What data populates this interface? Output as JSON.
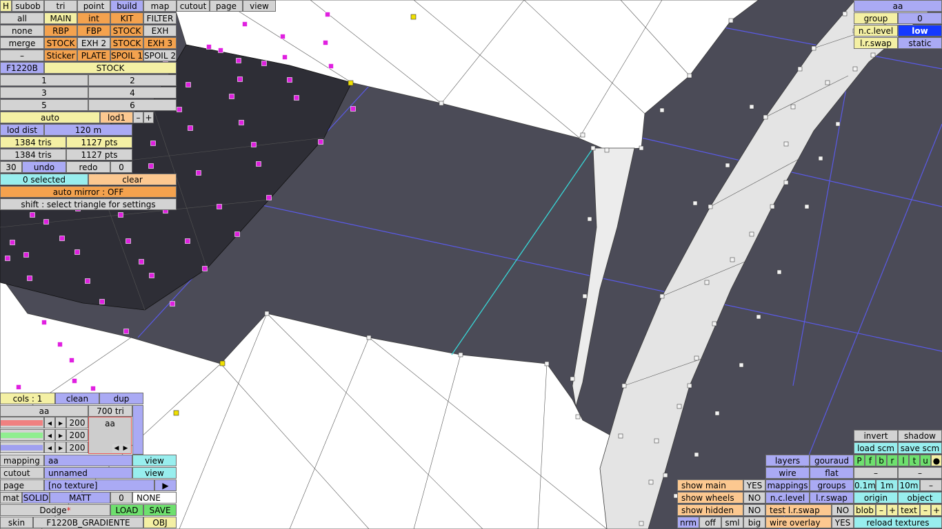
{
  "colors": {
    "background": "#4b4b57",
    "mesh_fill": "#ffffff",
    "wire": "#2a2a2a",
    "selected_vertex": "#e020e0",
    "yellow_vertex": "#f0e000",
    "axis_line": "#5a5ae8",
    "highlight_edge": "#38d8d8"
  },
  "top_menu": {
    "h": "H",
    "tabs": [
      "subob",
      "tri",
      "point",
      "build",
      "map",
      "cutout",
      "page",
      "view"
    ],
    "active_tab": "build"
  },
  "select": {
    "all": "all",
    "none": "none",
    "merge": "merge",
    "dash": "–",
    "grid": [
      [
        "MAIN",
        "int",
        "KIT",
        "FILTER"
      ],
      [
        "RBP",
        "FBP",
        "STOCK",
        "EXH"
      ],
      [
        "STOCK",
        "EXH 2",
        "STOCK",
        "EXH 3"
      ],
      [
        "Sticker",
        "PLATE",
        "SPOIL 1",
        "SPOIL 2"
      ]
    ]
  },
  "model": {
    "name": "F1220B",
    "variant": "STOCK"
  },
  "numbers": [
    "1",
    "2",
    "3",
    "4",
    "5",
    "6"
  ],
  "lod": {
    "auto": "auto",
    "current": "lod1",
    "minus": "–",
    "plus": "+",
    "dist_label": "lod dist",
    "dist_value": "120 m",
    "row1_tris": "1384 tris",
    "row1_pts": "1127 pts",
    "row2_tris": "1384 tris",
    "row2_pts": "1127 pts"
  },
  "history": {
    "count": "30",
    "undo": "undo",
    "redo": "redo",
    "redo_count": "0"
  },
  "selection": {
    "selected": "0 selected",
    "clear": "clear",
    "auto_mirror": "auto mirror : OFF",
    "hint": "shift : select triangle for settings"
  },
  "material": {
    "cols": "cols : 1",
    "clean": "clean",
    "dup": "dup",
    "name": "aa",
    "tri_count": "700 tri",
    "r": "200",
    "g": "200",
    "b": "200",
    "preview_name": "aa",
    "mapping_label": "mapping",
    "mapping_value": "aa",
    "mapping_view": "view",
    "cutout_label": "cutout",
    "cutout_value": "unnamed",
    "cutout_view": "view",
    "page_label": "page",
    "page_value": "[no texture]",
    "page_arrow": "▶",
    "mat": "mat",
    "solid": "SOLID",
    "matt": "MATT",
    "mat_num": "0",
    "mat_none": "NONE",
    "project_name": "Dodge",
    "project_star": "*",
    "load": "LOAD",
    "save": "SAVE",
    "skin_label": "skin",
    "skin_value": "F1220B_GRADIENTE",
    "obj": "OBJ"
  },
  "group_panel": {
    "title": "aa",
    "group_label": "group",
    "group_value": "0",
    "nc_level_label": "n.c.level",
    "nc_level_value": "low",
    "lr_swap_label": "l.r.swap",
    "lr_swap_value": "static"
  },
  "view_panel": {
    "invert": "invert",
    "shadow": "shadow",
    "load_scm": "load scm",
    "save_scm": "save scm",
    "layers": "layers",
    "gouraud": "gouraud",
    "wire": "wire",
    "flat": "flat",
    "mappings": "mappings",
    "groups": "groups",
    "dist_01": "0.1m",
    "dist_1": "1m",
    "dist_10": "10m",
    "nc_level": "n.c.level",
    "lr_swap": "l.r.swap",
    "origin": "origin",
    "object": "object",
    "test_lr_swap": "test l.r.swap",
    "test_lr_value": "NO",
    "blob": "blob",
    "text": "text",
    "minus": "–",
    "plus": "+",
    "wire_overlay": "wire overlay",
    "wire_overlay_value": "YES",
    "reload_textures": "reload textures",
    "filter_letters": [
      "P",
      "f",
      "b",
      "r",
      "l",
      "t",
      "u"
    ],
    "dash": "–",
    "show_main": "show main",
    "show_main_value": "YES",
    "show_wheels": "show wheels",
    "show_wheels_value": "NO",
    "show_hidden": "show hidden",
    "show_hidden_value": "NO",
    "nrm": "nrm",
    "off": "off",
    "sml": "sml",
    "big": "big"
  }
}
